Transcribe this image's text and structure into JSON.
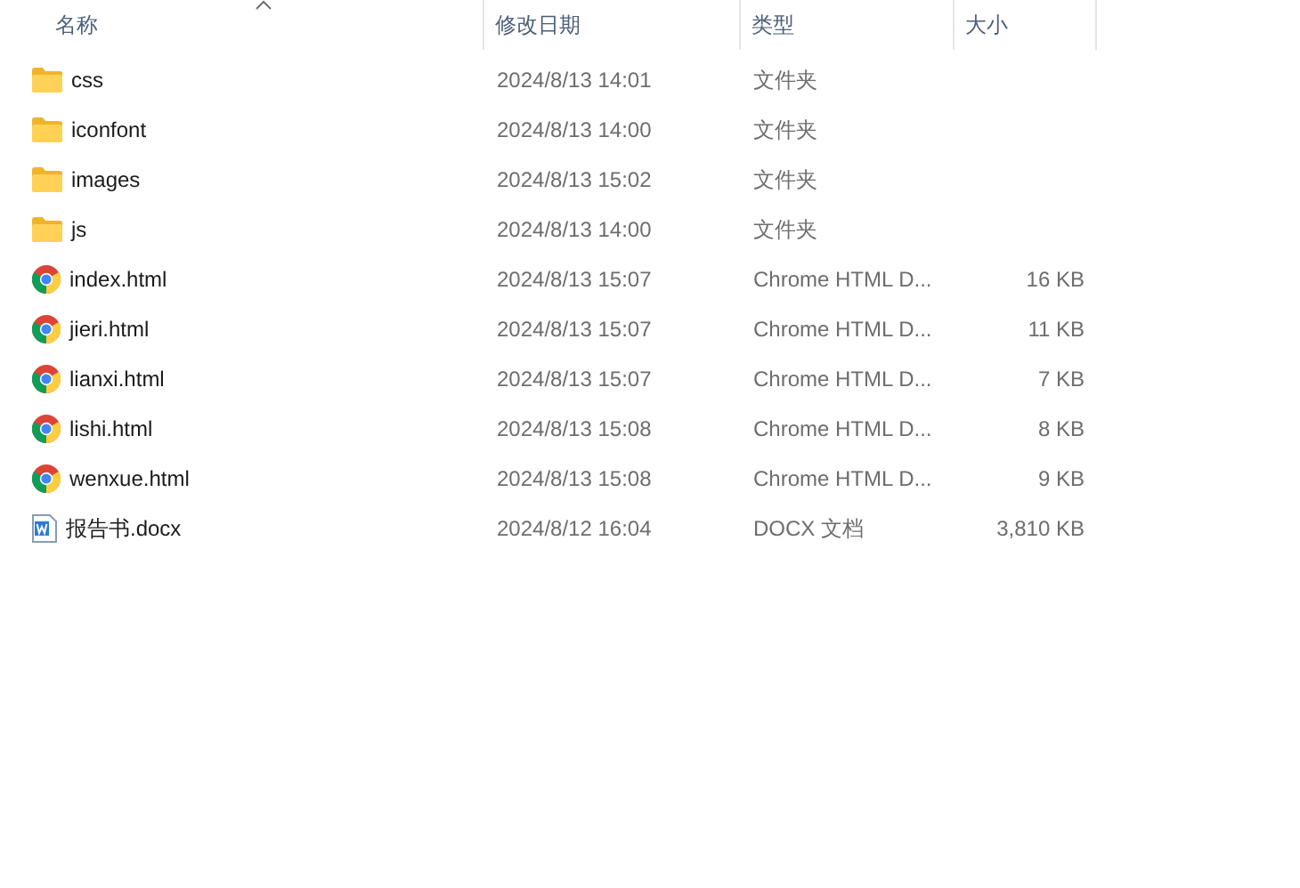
{
  "columns": [
    {
      "label": "名称",
      "sorted": true
    },
    {
      "label": "修改日期",
      "sorted": false
    },
    {
      "label": "类型",
      "sorted": false
    },
    {
      "label": "大小",
      "sorted": false
    }
  ],
  "rows": [
    {
      "kind": "folder",
      "name": "css",
      "date": "2024/8/13 14:01",
      "type": "文件夹"
    },
    {
      "kind": "folder",
      "name": "iconfont",
      "date": "2024/8/13 14:00",
      "type": "文件夹"
    },
    {
      "kind": "folder",
      "name": "images",
      "date": "2024/8/13 15:02",
      "type": "文件夹"
    },
    {
      "kind": "folder",
      "name": "js",
      "date": "2024/8/13 14:00",
      "type": "文件夹"
    },
    {
      "kind": "chrome",
      "name": "index.html",
      "date": "2024/8/13 15:07",
      "type": "Chrome HTML D...",
      "size": "16 KB"
    },
    {
      "kind": "chrome",
      "name": "jieri.html",
      "date": "2024/8/13 15:07",
      "type": "Chrome HTML D...",
      "size": "11 KB"
    },
    {
      "kind": "chrome",
      "name": "lianxi.html",
      "date": "2024/8/13 15:07",
      "type": "Chrome HTML D...",
      "size": "7 KB"
    },
    {
      "kind": "chrome",
      "name": "lishi.html",
      "date": "2024/8/13 15:08",
      "type": "Chrome HTML D...",
      "size": "8 KB"
    },
    {
      "kind": "chrome",
      "name": "wenxue.html",
      "date": "2024/8/13 15:08",
      "type": "Chrome HTML D...",
      "size": "9 KB"
    },
    {
      "kind": "word",
      "name": "报告书.docx",
      "date": "2024/8/12 16:04",
      "type": "DOCX 文档",
      "size": "3,810 KB"
    }
  ]
}
